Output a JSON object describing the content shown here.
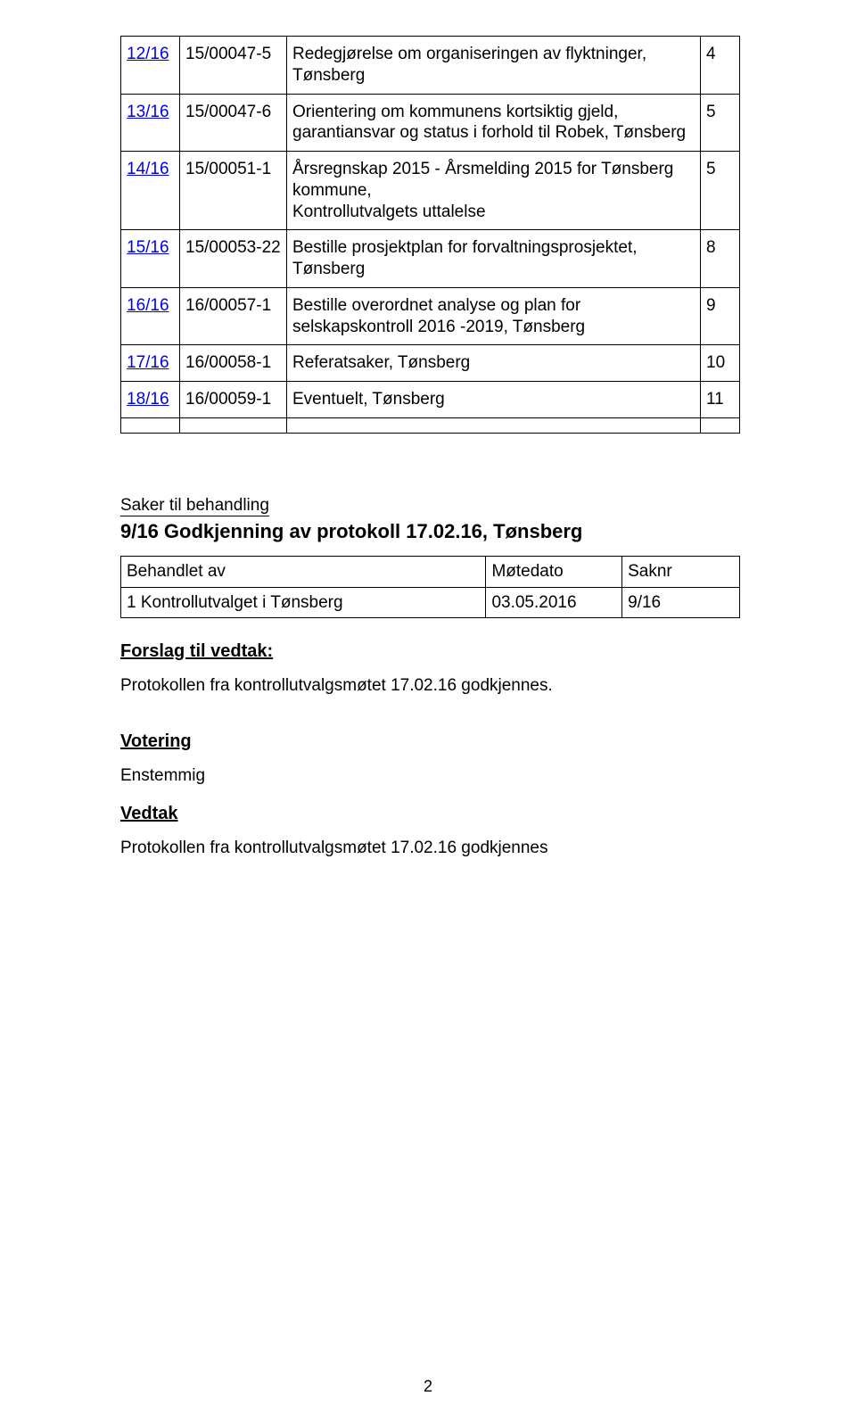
{
  "top_table": [
    {
      "c0": "12/16",
      "c1": "15/00047-5",
      "c2": "Redegjørelse om organiseringen av flyktninger, Tønsberg",
      "c3": "4",
      "link0": true
    },
    {
      "c0": "13/16",
      "c1": "15/00047-6",
      "c2": "Orientering om kommunens kortsiktig gjeld, garantiansvar og status i forhold til Robek, Tønsberg",
      "c3": "5",
      "link0": true
    },
    {
      "c0": "14/16",
      "c1": "15/00051-1",
      "c2": "Årsregnskap 2015 - Årsmelding 2015 for Tønsberg kommune,\nKontrollutvalgets uttalelse",
      "c3": "5",
      "link0": true
    },
    {
      "c0": "15/16",
      "c1": "15/00053-22",
      "c2": "Bestille prosjektplan for forvaltningsprosjektet, Tønsberg",
      "c3": "8",
      "link0": true
    },
    {
      "c0": "16/16",
      "c1": "16/00057-1",
      "c2": "Bestille overordnet analyse og plan for selskapskontroll 2016 -2019, Tønsberg",
      "c3": "9",
      "link0": true
    },
    {
      "c0": "17/16",
      "c1": "16/00058-1",
      "c2": "Referatsaker, Tønsberg",
      "c3": "10",
      "link0": true
    },
    {
      "c0": "18/16",
      "c1": "16/00059-1",
      "c2": "Eventuelt, Tønsberg",
      "c3": "11",
      "link0": true
    },
    {
      "c0": "",
      "c1": "",
      "c2": "",
      "c3": "",
      "link0": false
    }
  ],
  "section": {
    "sak_label": "Saker til behandling",
    "title": "9/16 Godkjenning av protokoll 17.02.16, Tønsberg"
  },
  "meta_table": {
    "headers": [
      "Behandlet av",
      "Møtedato",
      "Saknr"
    ],
    "row": [
      "1 Kontrollutvalget i Tønsberg",
      "03.05.2016",
      "9/16"
    ]
  },
  "forslag": {
    "heading": "Forslag til vedtak:",
    "text": "Protokollen fra kontrollutvalgsmøtet 17.02.16 godkjennes."
  },
  "votering": {
    "heading": "Votering",
    "text": "Enstemmig"
  },
  "vedtak": {
    "heading": "Vedtak",
    "text": "Protokollen fra kontrollutvalgsmøtet 17.02.16 godkjennes"
  },
  "page_number": "2"
}
